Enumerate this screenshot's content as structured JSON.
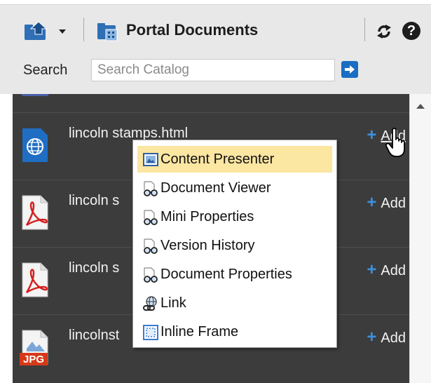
{
  "toolbar": {
    "up_icon": "folder-up-icon",
    "dropdown_icon": "chevron-down-icon",
    "portal_icon": "portal-documents-icon",
    "portal_label": "Portal Documents",
    "refresh_icon": "refresh-icon",
    "help_icon": "help-icon",
    "help_glyph": "?"
  },
  "search": {
    "label": "Search",
    "placeholder": "Search Catalog",
    "go_icon": "arrow-right-icon"
  },
  "catalog": {
    "items": [
      {
        "name": "lincoln stamps.html",
        "icon": "globe-html-icon",
        "add_label": "Add"
      },
      {
        "name": "lincoln s",
        "icon": "pdf-icon",
        "add_label": "Add"
      },
      {
        "name": "lincoln s",
        "icon": "pdf-icon",
        "add_label": "Add"
      },
      {
        "name": "lincolnst",
        "icon": "jpg-icon",
        "jpg_badge": "JPG",
        "add_label": "Add"
      }
    ]
  },
  "add_menu": {
    "items": [
      {
        "label": "Content Presenter",
        "icon": "content-presenter-icon",
        "highlighted": true
      },
      {
        "label": "Document Viewer",
        "icon": "viewer-glasses-icon"
      },
      {
        "label": "Mini Properties",
        "icon": "viewer-glasses-icon"
      },
      {
        "label": "Version History",
        "icon": "viewer-glasses-icon"
      },
      {
        "label": "Document Properties",
        "icon": "viewer-glasses-icon"
      },
      {
        "label": "Link",
        "icon": "link-icon"
      },
      {
        "label": "Inline Frame",
        "icon": "inline-frame-icon"
      }
    ]
  },
  "colors": {
    "panel_bg": "#3c3c3c",
    "menu_highlight": "#fbe6a2",
    "accent_blue": "#1a6dc2",
    "toolbar_bg": "#e8e8e8"
  }
}
